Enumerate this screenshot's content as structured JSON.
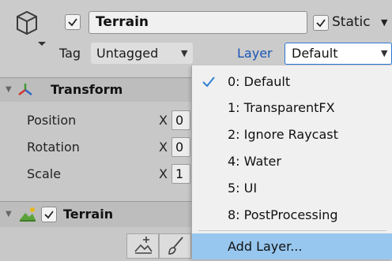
{
  "header": {
    "object_name": "Terrain",
    "active_checked": true,
    "static_label": "Static",
    "static_checked": true,
    "tag_label": "Tag",
    "tag_value": "Untagged",
    "layer_label": "Layer",
    "layer_value": "Default"
  },
  "transform": {
    "title": "Transform",
    "rows": [
      {
        "label": "Position",
        "axis": "X",
        "value": "0"
      },
      {
        "label": "Rotation",
        "axis": "X",
        "value": "0"
      },
      {
        "label": "Scale",
        "axis": "X",
        "value": "1"
      }
    ]
  },
  "terrain_component": {
    "title": "Terrain",
    "enabled": true,
    "tools": [
      "raise-terrain-icon",
      "paint-brush-icon"
    ]
  },
  "layer_menu": {
    "items": [
      {
        "label": "0: Default",
        "checked": true
      },
      {
        "label": "1: TransparentFX",
        "checked": false
      },
      {
        "label": "2: Ignore Raycast",
        "checked": false
      },
      {
        "label": "4: Water",
        "checked": false
      },
      {
        "label": "5: UI",
        "checked": false
      },
      {
        "label": "8: PostProcessing",
        "checked": false
      }
    ],
    "add_layer_label": "Add Layer..."
  },
  "colors": {
    "menu_hover": "#97c7ef",
    "check_blue": "#2f7fd3",
    "layer_label_blue": "#1a56b5"
  }
}
